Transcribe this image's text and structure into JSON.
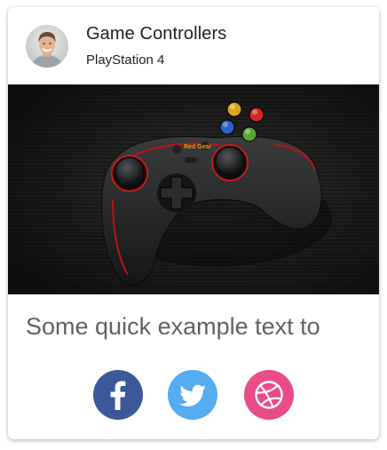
{
  "card": {
    "title": "Game Controllers",
    "subtitle": "PlayStation 4",
    "media_brand_text": "Red Gear",
    "body_text": "Some quick example text to"
  },
  "social": [
    {
      "name": "facebook",
      "icon": "facebook-icon",
      "color": "#3b5998"
    },
    {
      "name": "twitter",
      "icon": "twitter-icon",
      "color": "#55acee"
    },
    {
      "name": "dribbble",
      "icon": "dribbble-icon",
      "color": "#ea4c89"
    }
  ],
  "colors": {
    "card_background": "#ffffff",
    "title": "#212121",
    "body_text": "#616161"
  }
}
